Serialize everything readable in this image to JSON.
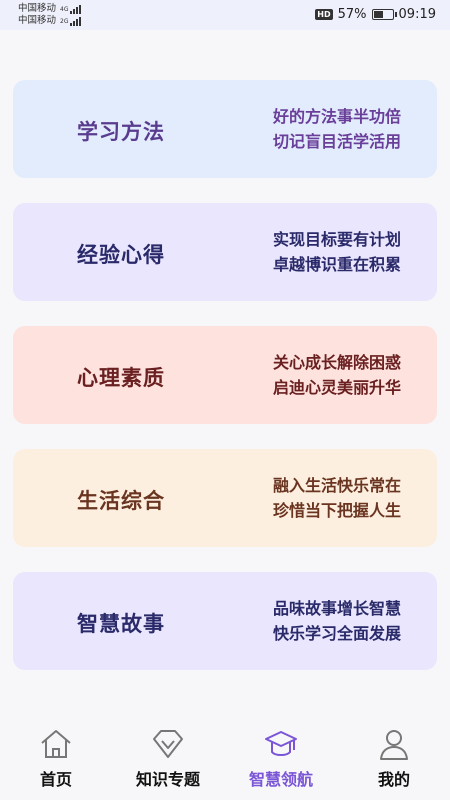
{
  "status_bar": {
    "carrier1": "中国移动",
    "carrier2": "中国移动",
    "net1": "4G",
    "net2": "2G",
    "battery_percent": "57%",
    "battery_level": 0.57,
    "time": "09:19",
    "hd": "HD"
  },
  "cards": [
    {
      "title": "学习方法",
      "line1": "好的方法事半功倍",
      "line2": "切记盲目活学活用",
      "bg": "#e2ecfd",
      "title_color": "#5a3c8f",
      "desc_color": "#6a3f9a"
    },
    {
      "title": "经验心得",
      "line1": "实现目标要有计划",
      "line2": "卓越博识重在积累",
      "bg": "#eae6fd",
      "title_color": "#2a2a6a",
      "desc_color": "#2a2a6a"
    },
    {
      "title": "心理素质",
      "line1": "关心成长解除困惑",
      "line2": "启迪心灵美丽升华",
      "bg": "#fde2de",
      "title_color": "#6a2020",
      "desc_color": "#6a2020"
    },
    {
      "title": "生活综合",
      "line1": "融入生活快乐常在",
      "line2": "珍惜当下把握人生",
      "bg": "#fdefe0",
      "title_color": "#6a3520",
      "desc_color": "#6a3520"
    },
    {
      "title": "智慧故事",
      "line1": "品味故事增长智慧",
      "line2": "快乐学习全面发展",
      "bg": "#e9e6fd",
      "title_color": "#2a2a6a",
      "desc_color": "#2a2a6a"
    }
  ],
  "tabs": [
    {
      "label": "首页",
      "icon": "home-icon"
    },
    {
      "label": "知识专题",
      "icon": "diamond-icon"
    },
    {
      "label": "智慧领航",
      "icon": "graduation-cap-icon",
      "active": true
    },
    {
      "label": "我的",
      "icon": "user-icon"
    }
  ],
  "colors": {
    "accent": "#7a55d6"
  }
}
